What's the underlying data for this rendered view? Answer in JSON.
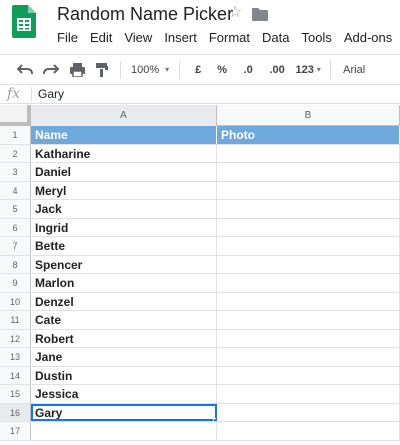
{
  "app": {
    "title": "Random Name Picker"
  },
  "menu": [
    "File",
    "Edit",
    "View",
    "Insert",
    "Format",
    "Data",
    "Tools",
    "Add-ons"
  ],
  "toolbar": {
    "zoom": "100%",
    "currency": "£",
    "percent": "%",
    "decrease_decimals": ".0",
    "increase_decimals": ".00",
    "more_formats": "123",
    "font": "Arial"
  },
  "formula_bar": {
    "fx": "fx",
    "value": "Gary"
  },
  "grid": {
    "columns": [
      "A",
      "B"
    ],
    "header": {
      "row": "1",
      "a": "Name",
      "b": "Photo"
    },
    "rows": [
      {
        "num": "2",
        "a": "Katharine"
      },
      {
        "num": "3",
        "a": "Daniel"
      },
      {
        "num": "4",
        "a": "Meryl"
      },
      {
        "num": "5",
        "a": "Jack"
      },
      {
        "num": "6",
        "a": "Ingrid"
      },
      {
        "num": "7",
        "a": "Bette"
      },
      {
        "num": "8",
        "a": "Spencer"
      },
      {
        "num": "9",
        "a": "Marlon"
      },
      {
        "num": "10",
        "a": "Denzel"
      },
      {
        "num": "11",
        "a": "Cate"
      },
      {
        "num": "12",
        "a": "Robert"
      },
      {
        "num": "13",
        "a": "Jane"
      },
      {
        "num": "14",
        "a": "Dustin"
      },
      {
        "num": "15",
        "a": "Jessica"
      },
      {
        "num": "16",
        "a": "Gary"
      },
      {
        "num": "17",
        "a": ""
      }
    ],
    "selected_row": "16"
  },
  "colors": {
    "header_fill": "#6fa8dc",
    "sheets_green": "#0f9d58",
    "selection": "#1a73e8"
  }
}
